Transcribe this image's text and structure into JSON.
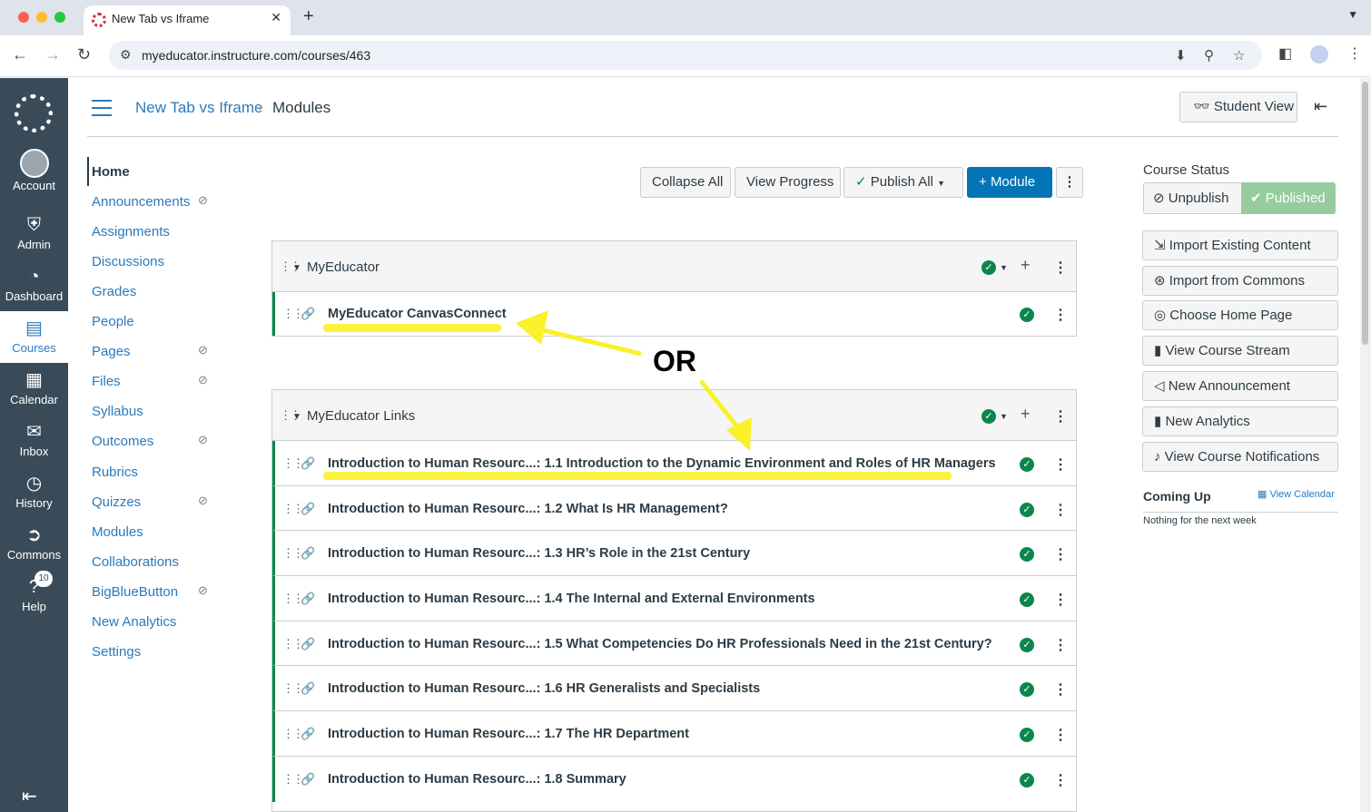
{
  "browser": {
    "tab_title": "New Tab vs Iframe",
    "url": "myeducator.instructure.com/courses/463"
  },
  "global_nav": {
    "account": "Account",
    "admin": "Admin",
    "dashboard": "Dashboard",
    "courses": "Courses",
    "calendar": "Calendar",
    "inbox": "Inbox",
    "history": "History",
    "commons": "Commons",
    "help": "Help",
    "help_badge": "10"
  },
  "header": {
    "course_name": "New Tab vs Iframe",
    "separator": "›",
    "current_page": "Modules",
    "student_view": "Student View"
  },
  "course_nav": {
    "items": [
      {
        "label": "Home"
      },
      {
        "label": "Announcements"
      },
      {
        "label": "Assignments"
      },
      {
        "label": "Discussions"
      },
      {
        "label": "Grades"
      },
      {
        "label": "People"
      },
      {
        "label": "Pages"
      },
      {
        "label": "Files"
      },
      {
        "label": "Syllabus"
      },
      {
        "label": "Outcomes"
      },
      {
        "label": "Rubrics"
      },
      {
        "label": "Quizzes"
      },
      {
        "label": "Modules"
      },
      {
        "label": "Collaborations"
      },
      {
        "label": "BigBlueButton"
      },
      {
        "label": "New Analytics"
      },
      {
        "label": "Settings"
      }
    ]
  },
  "toolbar": {
    "collapse_all": "Collapse All",
    "view_progress": "View Progress",
    "publish_all": "Publish All",
    "add_module": "Module"
  },
  "modules": [
    {
      "title": "MyEducator",
      "items": [
        {
          "title": "MyEducator CanvasConnect"
        }
      ]
    },
    {
      "title": "MyEducator Links",
      "items": [
        {
          "title": "Introduction to Human Resourc...: 1.1 Introduction to the Dynamic Environment and Roles of HR Managers"
        },
        {
          "title": "Introduction to Human Resourc...: 1.2 What Is HR Management?"
        },
        {
          "title": "Introduction to Human Resourc...: 1.3 HR’s Role in the 21st Century"
        },
        {
          "title": "Introduction to Human Resourc...: 1.4 The Internal and External Environments"
        },
        {
          "title": "Introduction to Human Resourc...: 1.5 What Competencies Do HR Professionals Need in the 21st Century?"
        },
        {
          "title": "Introduction to Human Resourc...: 1.6 HR Generalists and Specialists"
        },
        {
          "title": "Introduction to Human Resourc...: 1.7 The HR Department"
        },
        {
          "title": "Introduction to Human Resourc...: 1.8 Summary"
        }
      ]
    }
  ],
  "annotation": {
    "or_text": "OR",
    "highlight_color": "#f9f12a"
  },
  "sidebar": {
    "course_status": "Course Status",
    "unpublish": "Unpublish",
    "published": "Published",
    "buttons": [
      {
        "label": "Import Existing Content",
        "icon": "import-icon"
      },
      {
        "label": "Import from Commons",
        "icon": "commons-icon"
      },
      {
        "label": "Choose Home Page",
        "icon": "target-icon"
      },
      {
        "label": "View Course Stream",
        "icon": "bar-chart-icon"
      },
      {
        "label": "New Announcement",
        "icon": "megaphone-icon"
      },
      {
        "label": "New Analytics",
        "icon": "bar-chart-icon"
      },
      {
        "label": "View Course Notifications",
        "icon": "bell-icon"
      }
    ],
    "coming_up": "Coming Up",
    "view_calendar": "View Calendar",
    "nothing": "Nothing for the next week"
  },
  "colors": {
    "canvas_nav": "#394b58",
    "link_blue": "#2b7abc",
    "primary_button": "#0374b5",
    "published_green": "#0b874b"
  }
}
